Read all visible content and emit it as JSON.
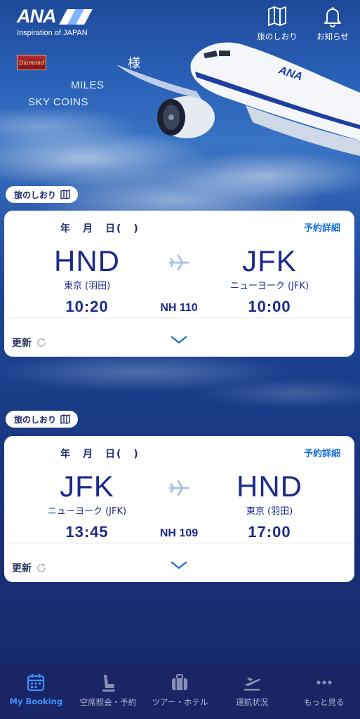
{
  "header": {
    "logo_text": "ANA",
    "logo_tagline": "Inspiration of JAPAN",
    "travel_guide_label": "旅のしおり",
    "notifications_label": "お知らせ",
    "status_badge_text": "Diamond",
    "honorific": "様",
    "miles_label": "MILES",
    "sky_coins_label": "SKY COINS"
  },
  "bookings": [
    {
      "section_label": "旅のしおり",
      "date": "年　月　日(　)",
      "detail_link": "予約詳細",
      "origin_code": "HND",
      "origin_city": "東京 (羽田)",
      "origin_time": "10:20",
      "flight_no": "NH 110",
      "dest_code": "JFK",
      "dest_city": "ニューヨーク (JFK)",
      "dest_time": "10:00",
      "refresh_label": "更新"
    },
    {
      "section_label": "旅のしおり",
      "date": "年　月　日(　)",
      "detail_link": "予約詳細",
      "origin_code": "JFK",
      "origin_city": "ニューヨーク (JFK)",
      "origin_time": "13:45",
      "flight_no": "NH 109",
      "dest_code": "HND",
      "dest_city": "東京 (羽田)",
      "dest_time": "17:00",
      "refresh_label": "更新"
    }
  ],
  "tabs": [
    {
      "label": "My Booking",
      "icon": "calendar-icon",
      "active": true
    },
    {
      "label": "空席照会・予約",
      "icon": "seat-icon",
      "active": false
    },
    {
      "label": "ツアー・ホテル",
      "icon": "suitcase-icon",
      "active": false
    },
    {
      "label": "運航状況",
      "icon": "departure-icon",
      "active": false
    },
    {
      "label": "もっと見る",
      "icon": "more-icon",
      "active": false
    }
  ],
  "colors": {
    "brand_navy": "#1d2a8c",
    "link_blue": "#1b6fd6",
    "tab_active": "#3f92ff",
    "tabbar_bg": "#1a2565"
  }
}
